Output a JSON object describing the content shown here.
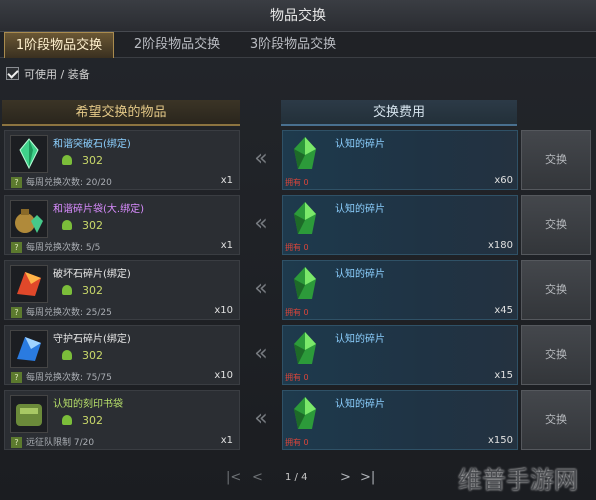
{
  "window": {
    "title": "物品交换"
  },
  "tabs": [
    {
      "label": "1阶段物品交换",
      "active": true
    },
    {
      "label": "2阶段物品交换",
      "active": false
    },
    {
      "label": "3阶段物品交换",
      "active": false
    }
  ],
  "filter": {
    "label": "可使用 / 装备",
    "checked": true
  },
  "columns": {
    "left": "希望交换的物品",
    "right": "交换费用"
  },
  "rows": [
    {
      "name": "和谐突破石(绑定)",
      "name_color": "#8cd0ff",
      "price": "302",
      "limit": "每周兑换次数: 20/20",
      "qty": "x1",
      "cost_name": "认知的碎片",
      "owned": "拥有 0",
      "cost_qty": "x60",
      "button": "交换",
      "icon": "green-crystal-icon"
    },
    {
      "name": "和谐碎片袋(大.绑定)",
      "name_color": "#d98cff",
      "price": "302",
      "limit": "每周兑换次数: 5/5",
      "qty": "x1",
      "cost_name": "认知的碎片",
      "owned": "拥有 0",
      "cost_qty": "x180",
      "button": "交换",
      "icon": "pouch-icon"
    },
    {
      "name": "破坏石碎片(绑定)",
      "name_color": "#e8e8e8",
      "price": "302",
      "limit": "每周兑换次数: 25/25",
      "qty": "x10",
      "cost_name": "认知的碎片",
      "owned": "拥有 0",
      "cost_qty": "x45",
      "button": "交换",
      "icon": "red-shard-icon"
    },
    {
      "name": "守护石碎片(绑定)",
      "name_color": "#e8e8e8",
      "price": "302",
      "limit": "每周兑换次数: 75/75",
      "qty": "x10",
      "cost_name": "认知的碎片",
      "owned": "拥有 0",
      "cost_qty": "x15",
      "button": "交换",
      "icon": "blue-shard-icon"
    },
    {
      "name": "认知的刻印书袋",
      "name_color": "#b7e06a",
      "price": "302",
      "limit": "远征队限制 7/20",
      "qty": "x1",
      "cost_name": "认知的碎片",
      "owned": "拥有 0",
      "cost_qty": "x150",
      "button": "交换",
      "icon": "book-bag-icon"
    }
  ],
  "pager": {
    "first": "K",
    "prev": "<",
    "page": "1 / 4",
    "next": ">",
    "last": "K"
  },
  "watermark": "维普手游网"
}
